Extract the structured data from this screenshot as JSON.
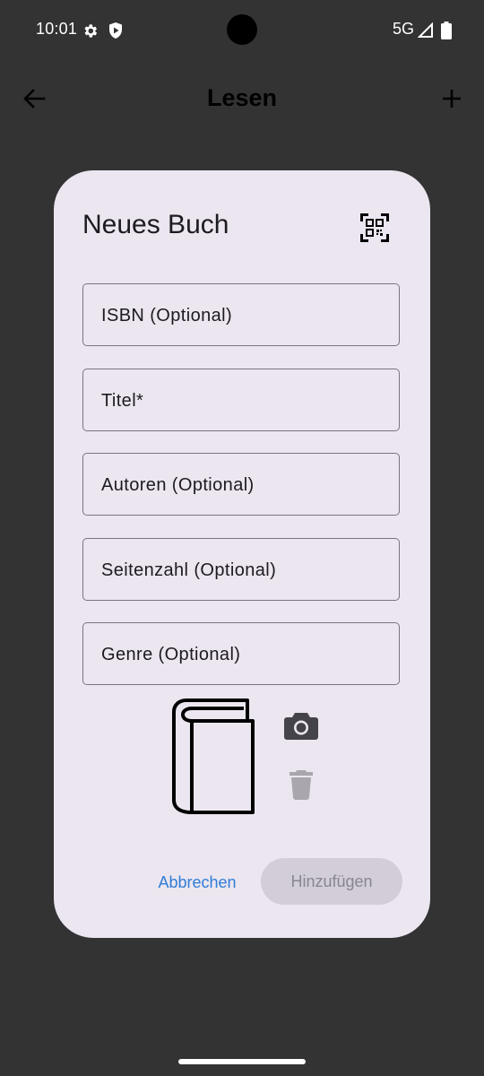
{
  "status_bar": {
    "time": "10:01",
    "network": "5G",
    "icons": [
      "settings-gear-icon",
      "shield-play-icon",
      "signal-icon",
      "battery-icon"
    ]
  },
  "app_bar": {
    "title": "Lesen",
    "back_icon": "arrow-back-icon",
    "add_icon": "plus-icon"
  },
  "dialog": {
    "title": "Neues Buch",
    "scan_icon": "qr-code-scan-icon",
    "fields": [
      {
        "label": "ISBN (Optional)",
        "value": ""
      },
      {
        "label": "Titel*",
        "value": ""
      },
      {
        "label": "Autoren (Optional)",
        "value": ""
      },
      {
        "label": "Seitenzahl (Optional)",
        "value": ""
      },
      {
        "label": "Genre (Optional)",
        "value": ""
      }
    ],
    "cover_placeholder_icon": "book-icon",
    "camera_icon": "camera-icon",
    "delete_icon": "trash-icon",
    "buttons": {
      "cancel": "Abbrechen",
      "add": "Hinzufügen",
      "add_enabled": false
    }
  },
  "colors": {
    "background": "#333333",
    "dialog_surface": "#ece6f0",
    "accent_text": "#2f7dd6",
    "disabled_button": "#d2cdd6",
    "disabled_text": "#888690"
  }
}
